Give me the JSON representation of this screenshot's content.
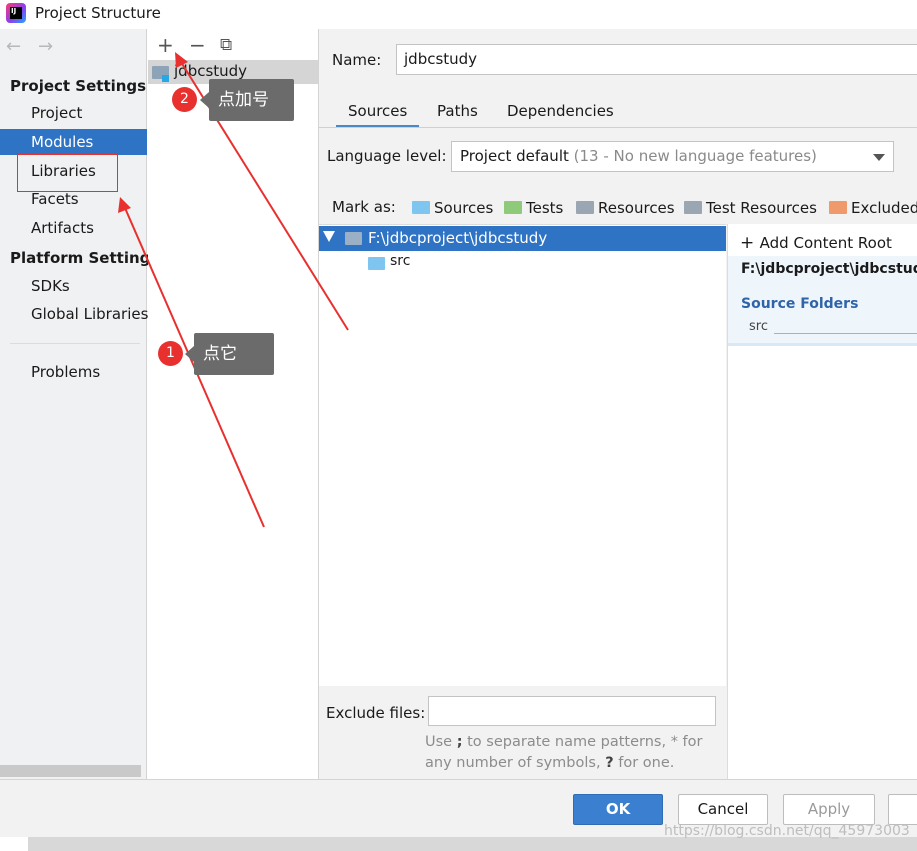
{
  "window": {
    "title": "Project Structure"
  },
  "nav": {
    "back": "←",
    "forward": "→",
    "project_settings": "Project Settings",
    "project_items": [
      "Project",
      "Modules",
      "Libraries",
      "Facets",
      "Artifacts"
    ],
    "platform_settings": "Platform Settings",
    "platform_items": [
      "SDKs",
      "Global Libraries"
    ],
    "problems": "Problems",
    "selected": "Modules"
  },
  "modules_panel": {
    "add": "+",
    "remove": "−",
    "copy": "⧉",
    "module": "jdbcstudy"
  },
  "module": {
    "name_label": "Name:",
    "name_value": "jdbcstudy",
    "tabs": [
      "Sources",
      "Paths",
      "Dependencies"
    ],
    "selected_tab": "Sources",
    "language_level_label": "Language level:",
    "language_level_value": "Project default",
    "language_level_hint": "(13 - No new language features)",
    "mark_as_label": "Mark as:",
    "mark_as": [
      {
        "label": "Sources",
        "color": "#7ec5ef"
      },
      {
        "label": "Tests",
        "color": "#8fc97a"
      },
      {
        "label": "Resources",
        "color": "#9aa7b3"
      },
      {
        "label": "Test Resources",
        "color": "#9aa7b3"
      },
      {
        "label": "Excluded",
        "color": "#f09a6b"
      }
    ],
    "tree_root": "F:\\jdbcproject\\jdbcstudy",
    "tree_child": "src",
    "add_content_root": "Add Content Root",
    "content_root_path": "F:\\jdbcproject\\jdbcstudy",
    "source_folders_label": "Source Folders",
    "source_folder_item": "src",
    "exclude_files_label": "Exclude files:",
    "exclude_files_value": "",
    "exclude_hint_1": "Use",
    "exclude_hint_semicolon": ";",
    "exclude_hint_2": "to separate name patterns, * for any number of symbols,",
    "exclude_hint_q": "?",
    "exclude_hint_3": "for one."
  },
  "buttons": {
    "ok": "OK",
    "cancel": "Cancel",
    "apply": "Apply"
  },
  "annotations": {
    "step1_num": "1",
    "step1_text": "点它",
    "step2_num": "2",
    "step2_text": "点加号",
    "color": "#e8312f"
  },
  "watermark": "https://blog.csdn.net/qq_45973003"
}
